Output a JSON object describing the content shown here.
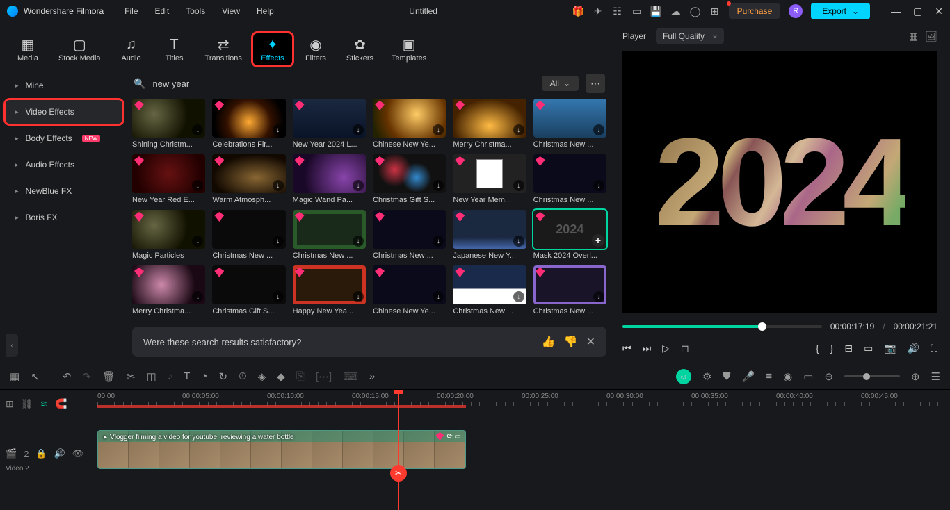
{
  "app": {
    "name": "Wondershare Filmora",
    "document": "Untitled"
  },
  "menus": [
    "File",
    "Edit",
    "Tools",
    "View",
    "Help"
  ],
  "titlebar": {
    "purchase": "Purchase",
    "avatar_initial": "R",
    "export": "Export"
  },
  "tabs": [
    {
      "label": "Media",
      "icon": "▦"
    },
    {
      "label": "Stock Media",
      "icon": "▢"
    },
    {
      "label": "Audio",
      "icon": "♫"
    },
    {
      "label": "Titles",
      "icon": "T"
    },
    {
      "label": "Transitions",
      "icon": "⇄"
    },
    {
      "label": "Effects",
      "icon": "✦",
      "active": true
    },
    {
      "label": "Filters",
      "icon": "◉"
    },
    {
      "label": "Stickers",
      "icon": "✿"
    },
    {
      "label": "Templates",
      "icon": "▣"
    }
  ],
  "sidebar": [
    {
      "label": "Mine"
    },
    {
      "label": "Video Effects",
      "highlighted": true
    },
    {
      "label": "Body Effects",
      "badge": "NEW"
    },
    {
      "label": "Audio Effects"
    },
    {
      "label": "NewBlue FX"
    },
    {
      "label": "Boris FX"
    }
  ],
  "search": {
    "query": "new year",
    "filter": "All"
  },
  "effects": [
    {
      "label": "Shining Christm...",
      "bg": "bg-dark-sparkle"
    },
    {
      "label": "Celebrations Fir...",
      "bg": "bg-fireworks"
    },
    {
      "label": "New Year 2024 L...",
      "bg": "bg-blue-sparkle"
    },
    {
      "label": "Chinese New Ye...",
      "bg": "bg-lantern"
    },
    {
      "label": "Merry Christma...",
      "bg": "bg-gold-tree"
    },
    {
      "label": "Christmas New ...",
      "bg": "bg-snow"
    },
    {
      "label": "New Year Red E...",
      "bg": "bg-red-gold"
    },
    {
      "label": "Warm Atmosph...",
      "bg": "bg-warm"
    },
    {
      "label": "Magic Wand Pa...",
      "bg": "bg-wand"
    },
    {
      "label": "Christmas Gift S...",
      "bg": "bg-bokeh"
    },
    {
      "label": "New Year Mem...",
      "bg": "bg-polaroid"
    },
    {
      "label": "Christmas New ...",
      "bg": "bg-stars-dark"
    },
    {
      "label": "Magic Particles",
      "bg": "bg-dark-sparkle"
    },
    {
      "label": "Christmas New ...",
      "bg": "bg-dark"
    },
    {
      "label": "Christmas New ...",
      "bg": "bg-green-border"
    },
    {
      "label": "Christmas New ...",
      "bg": "bg-stars-dark"
    },
    {
      "label": "Japanese New Y...",
      "bg": "bg-rising"
    },
    {
      "label": "Mask 2024 Overl...",
      "bg": "bg-2024",
      "selected": true,
      "text": "2024"
    },
    {
      "label": "Merry Christma...",
      "bg": "bg-pink-sparkle"
    },
    {
      "label": "Christmas Gift S...",
      "bg": "bg-dark"
    },
    {
      "label": "Happy New Yea...",
      "bg": "bg-red-frame"
    },
    {
      "label": "Chinese New Ye...",
      "bg": "bg-stars-dark"
    },
    {
      "label": "Christmas New ...",
      "bg": "bg-snow-house"
    },
    {
      "label": "Christmas New ...",
      "bg": "bg-purple-frame"
    }
  ],
  "feedback": {
    "text": "Were these search results satisfactory?"
  },
  "player": {
    "label": "Player",
    "quality": "Full Quality",
    "mask_text": "2024",
    "current": "00:00:17:19",
    "total": "00:00:21:21"
  },
  "timeline": {
    "marks": [
      "00:00",
      "00:00:05:00",
      "00:00:10:00",
      "00:00:15:00",
      "00:00:20:00",
      "00:00:25:00",
      "00:00:30:00",
      "00:00:35:00",
      "00:00:40:00",
      "00:00:45:00"
    ],
    "track_count": "2",
    "track_label": "Video 2",
    "clip_label": "Vlogger filming a video for youtube, reviewing a water bottle"
  }
}
